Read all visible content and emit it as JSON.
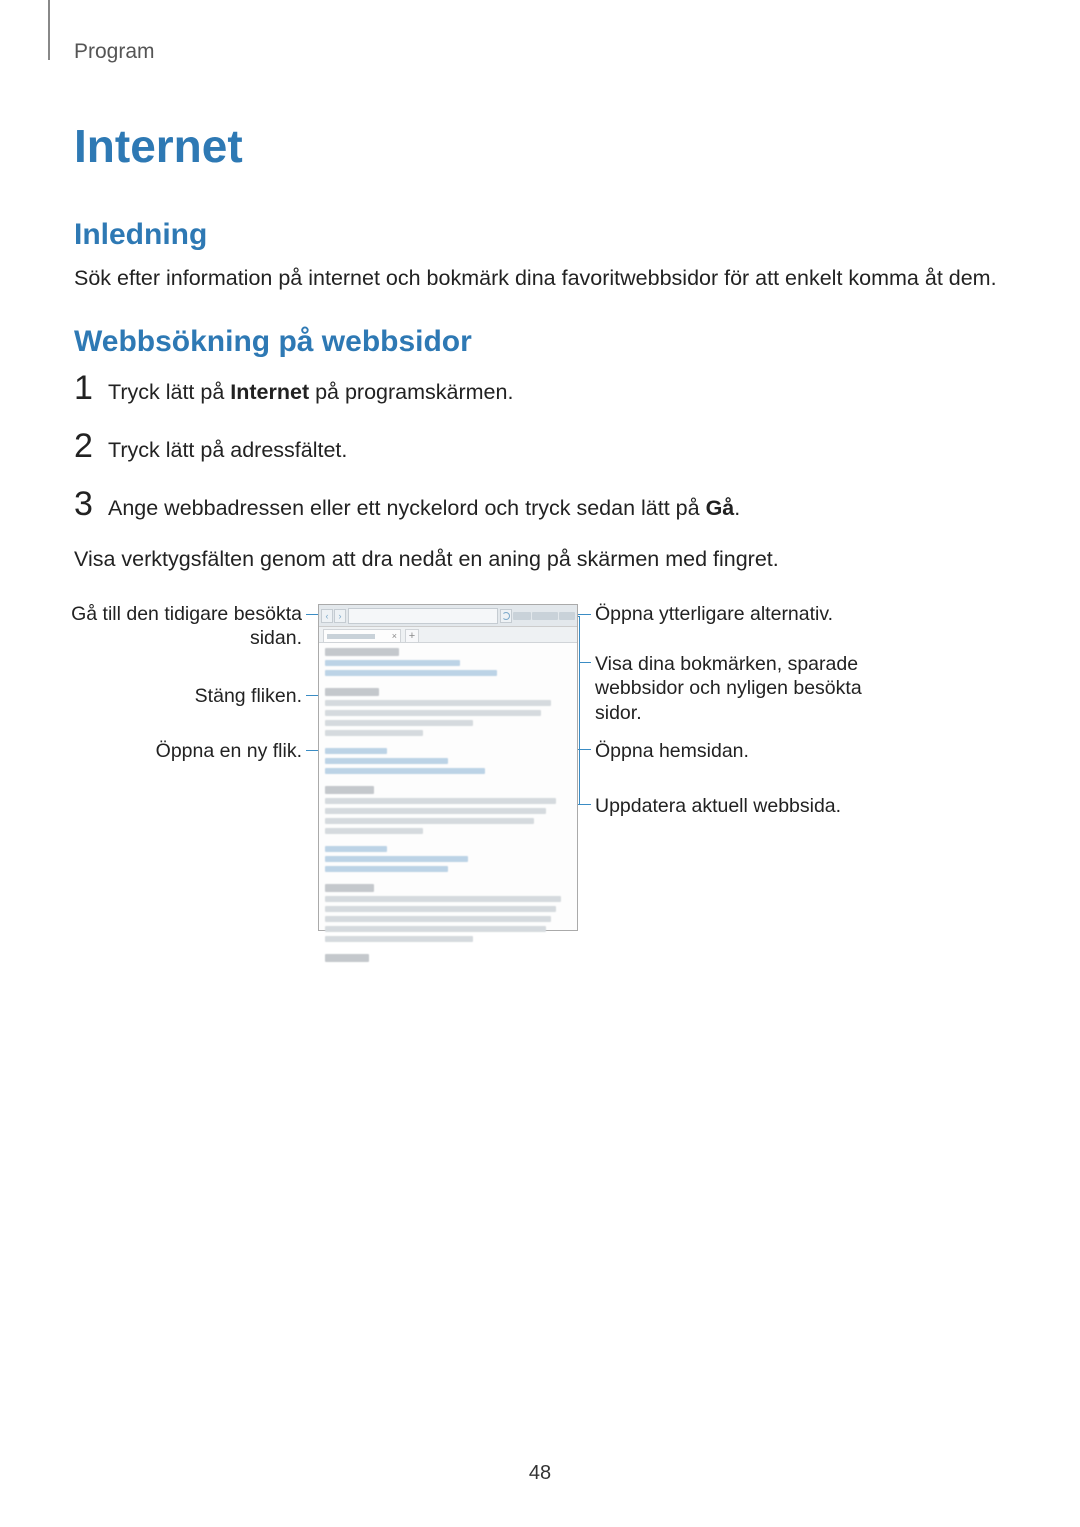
{
  "breadcrumb": "Program",
  "title": "Internet",
  "section1": {
    "heading": "Inledning",
    "body": "Sök efter information på internet och bokmärk dina favoritwebbsidor för att enkelt komma åt dem."
  },
  "section2": {
    "heading": "Webbsökning på webbsidor",
    "steps": [
      {
        "num": "1",
        "pre": "Tryck lätt på ",
        "bold": "Internet",
        "post": " på programskärmen."
      },
      {
        "num": "2",
        "pre": "Tryck lätt på adressfältet.",
        "bold": "",
        "post": ""
      },
      {
        "num": "3",
        "pre": "Ange webbadressen eller ett nyckelord och tryck sedan lätt på ",
        "bold": "Gå",
        "post": "."
      }
    ],
    "after": "Visa verktygsfälten genom att dra nedåt en aning på skärmen med fingret."
  },
  "callouts": {
    "left": {
      "back": "Gå till den tidigare besökta sidan.",
      "closeTab": "Stäng fliken.",
      "newTab": "Öppna en ny flik."
    },
    "right": {
      "more": "Öppna ytterligare alternativ.",
      "bookmarks": "Visa dina bokmärken, sparade webbsidor och nyligen besökta sidor.",
      "home": "Öppna hemsidan.",
      "refresh": "Uppdatera aktuell webbsida."
    }
  },
  "icons": {
    "back": "‹",
    "forward": "›",
    "close": "×",
    "plus": "+"
  },
  "pageNumber": "48"
}
